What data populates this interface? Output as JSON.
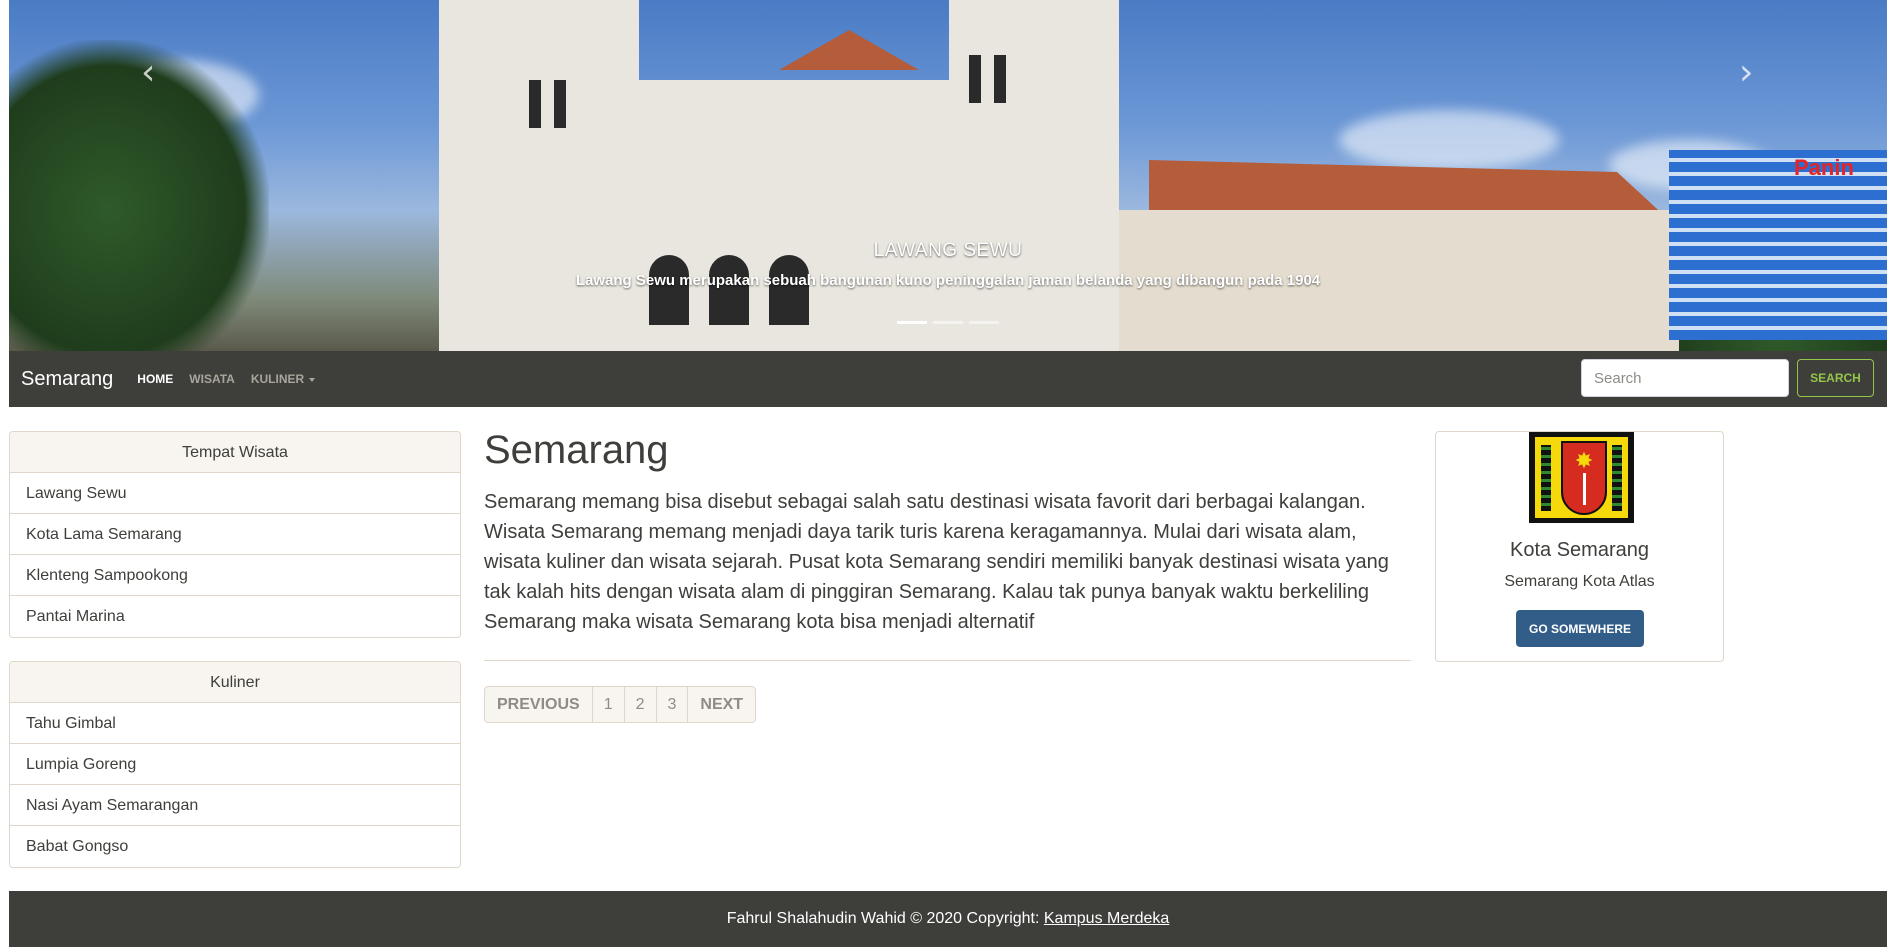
{
  "carousel": {
    "prev_arrow": "‹",
    "next_arrow": "›",
    "caption_title": "LAWANG SEWU",
    "caption_text": "Lawang Sewu merupakan sebuah bangunan kuno peninggalan jaman belanda yang dibangun pada 1904",
    "indicators": 3,
    "active_indicator": 1,
    "banner_sign": "Panin"
  },
  "navbar": {
    "brand": "Semarang",
    "links": [
      {
        "label": "HOME",
        "active": true
      },
      {
        "label": "WISATA",
        "active": false
      },
      {
        "label": "KULINER",
        "active": false,
        "dropdown": true
      }
    ],
    "search_placeholder": "Search",
    "search_button": "SEARCH"
  },
  "sidebar": {
    "wisata": {
      "header": "Tempat Wisata",
      "items": [
        "Lawang Sewu",
        "Kota Lama Semarang",
        "Klenteng Sampookong",
        "Pantai Marina"
      ]
    },
    "kuliner": {
      "header": "Kuliner",
      "items": [
        "Tahu Gimbal",
        "Lumpia Goreng",
        "Nasi Ayam Semarangan",
        "Babat Gongso"
      ]
    }
  },
  "main": {
    "title": "Semarang",
    "text": "Semarang memang bisa disebut sebagai salah satu destinasi wisata favorit dari berbagai kalangan. Wisata Semarang memang menjadi daya tarik turis karena keragamannya. Mulai dari wisata alam, wisata kuliner dan wisata sejarah. Pusat kota Semarang sendiri memiliki banyak destinasi wisata yang tak kalah hits dengan wisata alam di pinggiran Semarang. Kalau tak punya banyak waktu berkeliling Semarang maka wisata Semarang kota bisa menjadi alternatif",
    "pagination": {
      "previous": "PREVIOUS",
      "pages": [
        "1",
        "2",
        "3"
      ],
      "next": "NEXT"
    }
  },
  "card": {
    "title": "Kota Semarang",
    "text": "Semarang Kota Atlas",
    "button": "GO SOMEWHERE"
  },
  "footer": {
    "text": "Fahrul Shalahudin Wahid © 2020 Copyright: ",
    "link": "Kampus Merdeka"
  },
  "colors": {
    "navbar": "#3e3f3a",
    "accent_green": "#93c54b",
    "primary_blue": "#325d88",
    "border": "#dfd7ca"
  }
}
